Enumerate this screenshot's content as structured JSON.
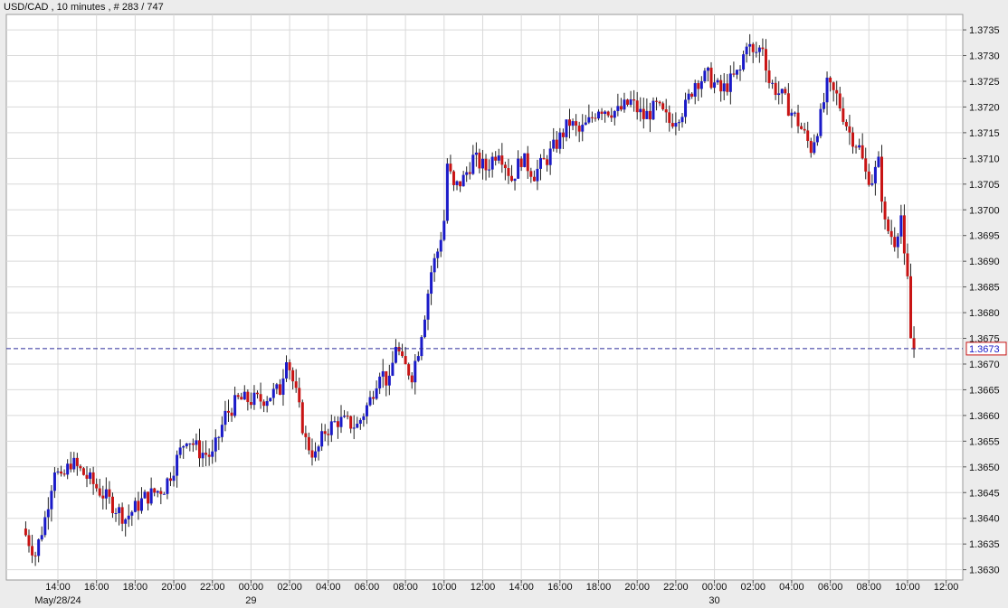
{
  "chart_data": {
    "type": "candlestick",
    "title": "USD/CAD , 10 minutes , # 283 / 747",
    "xlabel": "",
    "ylabel": "",
    "ylim": [
      1.3628,
      1.3738
    ],
    "y_ticks": [
      "1.3630",
      "1.3635",
      "1.3640",
      "1.3645",
      "1.3650",
      "1.3655",
      "1.3660",
      "1.3665",
      "1.3670",
      "1.3675",
      "1.3680",
      "1.3685",
      "1.3690",
      "1.3695",
      "1.3700",
      "1.3705",
      "1.3710",
      "1.3715",
      "1.3720",
      "1.3725",
      "1.3730",
      "1.3735"
    ],
    "x_ticks": [
      "14:00",
      "16:00",
      "18:00",
      "20:00",
      "22:00",
      "00:00",
      "02:00",
      "04:00",
      "06:00",
      "08:00",
      "10:00",
      "12:00",
      "14:00",
      "16:00",
      "18:00",
      "20:00",
      "22:00",
      "00:00",
      "02:00",
      "04:00",
      "06:00",
      "08:00",
      "10:00",
      "12:00"
    ],
    "date_labels": [
      {
        "label": "May/28/24",
        "under_tick": "14:00",
        "tick_index": 0
      },
      {
        "label": "29",
        "under_tick": "00:00",
        "tick_index": 5
      },
      {
        "label": "30",
        "under_tick": "00:00",
        "tick_index": 17
      }
    ],
    "current_price": "1.3673",
    "current_price_value": 1.3673,
    "grid": true,
    "up_color": "#1a1ac8",
    "down_color": "#c81414",
    "anchors": [
      {
        "time": "12:10",
        "price": 1.3638
      },
      {
        "time": "12:50",
        "price": 1.3633
      },
      {
        "time": "13:20",
        "price": 1.364
      },
      {
        "time": "13:50",
        "price": 1.365
      },
      {
        "time": "14:10",
        "price": 1.3647
      },
      {
        "time": "14:40",
        "price": 1.3651
      },
      {
        "time": "15:30",
        "price": 1.3648
      },
      {
        "time": "16:30",
        "price": 1.3644
      },
      {
        "time": "17:30",
        "price": 1.364
      },
      {
        "time": "18:30",
        "price": 1.3644
      },
      {
        "time": "19:30",
        "price": 1.3646
      },
      {
        "time": "20:00",
        "price": 1.365
      },
      {
        "time": "20:40",
        "price": 1.3656
      },
      {
        "time": "21:20",
        "price": 1.3653
      },
      {
        "time": "22:00",
        "price": 1.3652
      },
      {
        "time": "22:40",
        "price": 1.366
      },
      {
        "time": "23:20",
        "price": 1.3663
      },
      {
        "time": "00:30",
        "price": 1.3663
      },
      {
        "time": "01:30",
        "price": 1.3665
      },
      {
        "time": "01:50",
        "price": 1.3672
      },
      {
        "time": "02:20",
        "price": 1.3664
      },
      {
        "time": "02:50",
        "price": 1.3655
      },
      {
        "time": "03:20",
        "price": 1.3652
      },
      {
        "time": "03:50",
        "price": 1.3657
      },
      {
        "time": "04:30",
        "price": 1.3659
      },
      {
        "time": "05:30",
        "price": 1.3658
      },
      {
        "time": "06:10",
        "price": 1.3663
      },
      {
        "time": "06:40",
        "price": 1.3669
      },
      {
        "time": "07:10",
        "price": 1.3666
      },
      {
        "time": "07:30",
        "price": 1.3674
      },
      {
        "time": "07:50",
        "price": 1.367
      },
      {
        "time": "08:20",
        "price": 1.3668
      },
      {
        "time": "08:40",
        "price": 1.3673
      },
      {
        "time": "09:00",
        "price": 1.368
      },
      {
        "time": "09:20",
        "price": 1.3688
      },
      {
        "time": "09:40",
        "price": 1.3692
      },
      {
        "time": "10:00",
        "price": 1.3698
      },
      {
        "time": "10:10",
        "price": 1.3709
      },
      {
        "time": "10:30",
        "price": 1.3704
      },
      {
        "time": "11:00",
        "price": 1.3706
      },
      {
        "time": "11:30",
        "price": 1.371
      },
      {
        "time": "12:10",
        "price": 1.3708
      },
      {
        "time": "12:50",
        "price": 1.3712
      },
      {
        "time": "13:30",
        "price": 1.3706
      },
      {
        "time": "14:00",
        "price": 1.371
      },
      {
        "time": "14:40",
        "price": 1.3707
      },
      {
        "time": "15:20",
        "price": 1.371
      },
      {
        "time": "16:00",
        "price": 1.3714
      },
      {
        "time": "16:30",
        "price": 1.3717
      },
      {
        "time": "17:00",
        "price": 1.3715
      },
      {
        "time": "17:30",
        "price": 1.3717
      },
      {
        "time": "18:00",
        "price": 1.372
      },
      {
        "time": "19:00",
        "price": 1.3719
      },
      {
        "time": "19:40",
        "price": 1.3721
      },
      {
        "time": "20:20",
        "price": 1.3718
      },
      {
        "time": "21:00",
        "price": 1.372
      },
      {
        "time": "21:40",
        "price": 1.3717
      },
      {
        "time": "22:30",
        "price": 1.372
      },
      {
        "time": "23:00",
        "price": 1.3725
      },
      {
        "time": "23:40",
        "price": 1.3726
      },
      {
        "time": "00:20",
        "price": 1.3723
      },
      {
        "time": "00:50",
        "price": 1.3725
      },
      {
        "time": "01:20",
        "price": 1.3727
      },
      {
        "time": "01:40",
        "price": 1.3733
      },
      {
        "time": "02:00",
        "price": 1.373
      },
      {
        "time": "02:30",
        "price": 1.3732
      },
      {
        "time": "02:50",
        "price": 1.3725
      },
      {
        "time": "03:30",
        "price": 1.3722
      },
      {
        "time": "04:20",
        "price": 1.3717
      },
      {
        "time": "05:00",
        "price": 1.3712
      },
      {
        "time": "05:30",
        "price": 1.3718
      },
      {
        "time": "05:50",
        "price": 1.3724
      },
      {
        "time": "06:20",
        "price": 1.3722
      },
      {
        "time": "07:00",
        "price": 1.3715
      },
      {
        "time": "07:30",
        "price": 1.3712
      },
      {
        "time": "07:50",
        "price": 1.3707
      },
      {
        "time": "08:10",
        "price": 1.3706
      },
      {
        "time": "08:30",
        "price": 1.3709
      },
      {
        "time": "08:50",
        "price": 1.3697
      },
      {
        "time": "09:20",
        "price": 1.3694
      },
      {
        "time": "09:40",
        "price": 1.3699
      },
      {
        "time": "09:50",
        "price": 1.369
      },
      {
        "time": "10:00",
        "price": 1.3686
      },
      {
        "time": "10:10",
        "price": 1.3675
      },
      {
        "time": "10:20",
        "price": 1.3673
      }
    ]
  }
}
